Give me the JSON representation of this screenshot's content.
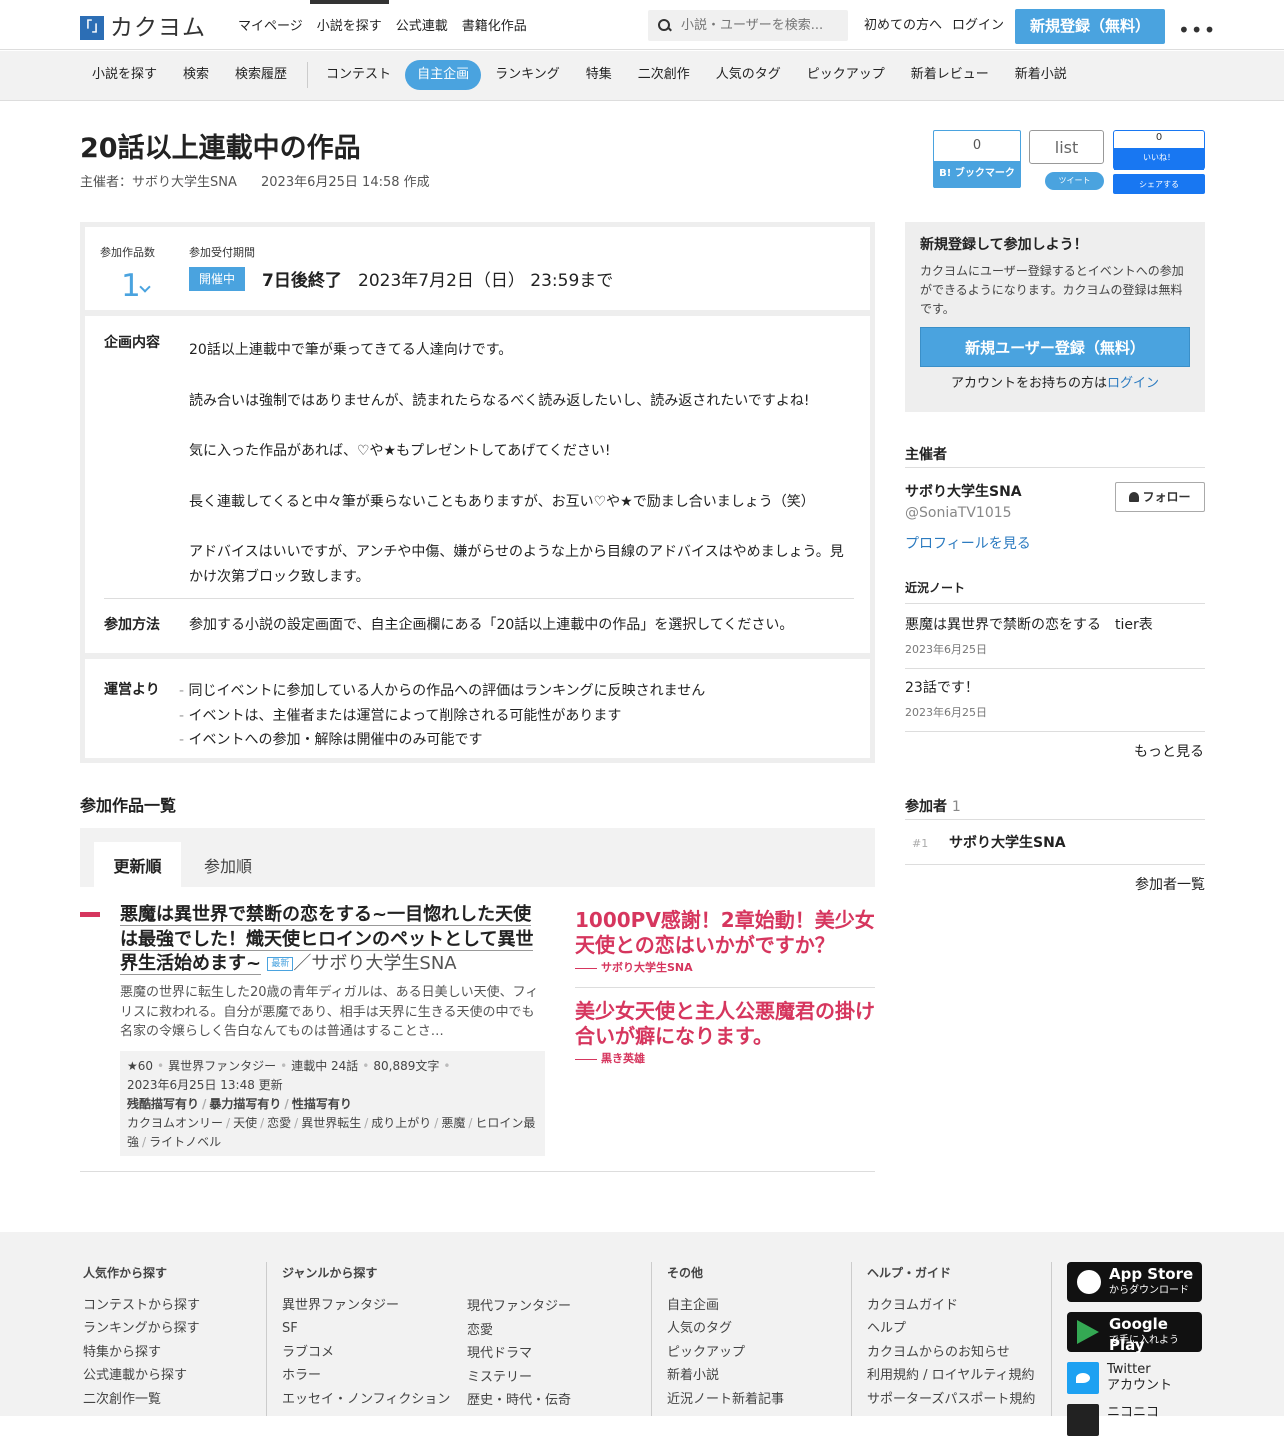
{
  "header": {
    "logo_mark": "「」",
    "logo_text": "カクヨム",
    "nav": [
      "マイページ",
      "小説を探す",
      "公式連載",
      "書籍化作品"
    ],
    "search_placeholder": "小説・ユーザーを検索...",
    "first_time": "初めての方へ",
    "login": "ログイン",
    "signup": "新規登録（無料）",
    "more": "•••"
  },
  "subnav": {
    "left": [
      "小説を探す",
      "検索",
      "検索履歴"
    ],
    "right": [
      "コンテスト",
      "自主企画",
      "ランキング",
      "特集",
      "二次創作",
      "人気のタグ",
      "ピックアップ",
      "新着レビュー",
      "新着小説"
    ]
  },
  "event": {
    "title": "20話以上連載中の作品",
    "organizer": "主催者：サボり大学生SNA",
    "created": "2023年6月25日 14:58 作成",
    "count_label": "参加作品数",
    "count": "1",
    "period_label": "参加受付期間",
    "status": "開催中",
    "remaining": "7日後終了",
    "deadline": "2023年7月2日（日） 23:59まで",
    "content_label": "企画内容",
    "content": [
      "20話以上連載中で筆が乗ってきてる人達向けです。",
      "読み合いは強制ではありませんが、読まれたらなるべく読み返したいし、読み返されたいですよね!",
      "気に入った作品があれば、♡や★もプレゼントしてあげてください!",
      "長く連載してくると中々筆が乗らないこともありますが、お互い♡や★で励まし合いましょう（笑）",
      "アドバイスはいいですが、アンチや中傷、嫌がらせのような上から目線のアドバイスはやめましょう。見かけ次第ブロック致します。"
    ],
    "method_label": "参加方法",
    "method": "参加する小説の設定画面で、自主企画欄にある「20話以上連載中の作品」を選択してください。",
    "notes_label": "運営より",
    "notes": [
      "同じイベントに参加している人からの作品への評価はランキングに反映されません",
      "イベントは、主催者または運営によって削除される可能性があります",
      "イベントへの参加・解除は開催中のみ可能です"
    ]
  },
  "share": {
    "hatena_count": "0",
    "hatena_label": "B! ブックマーク",
    "list_label": "list",
    "tweet_label": "ツイート",
    "fb_count": "0",
    "fb_like": "いいね！",
    "fb_share": "シェアする"
  },
  "works": {
    "section_title": "参加作品一覧",
    "tabs": [
      "更新順",
      "参加順"
    ],
    "item": {
      "title": "悪魔は異世界で禁断の恋をする~一目惚れした天使は最強でした！熾天使ヒロインのペットとして異世界生活始めます~",
      "new_badge": "最新",
      "author": "／サボり大学生SNA",
      "intro": "悪魔の世界に転生した20歳の青年ディガルは、ある日美しい天使、フィリスに救われる。自分が悪魔であり、相手は天界に生きる天使の中でも名家の令嬢らしく告白なんてものは普通はすることさ…",
      "stars": "★60",
      "genre": "異世界ファンタジー",
      "episodes": "連載中 24話",
      "chars": "80,889文字",
      "updated": "2023年6月25日 13:48 更新",
      "warnings": [
        "残酷描写有り",
        "暴力描写有り",
        "性描写有り"
      ],
      "tags": [
        "カクヨムオンリー",
        "天使",
        "恋愛",
        "異世界転生",
        "成り上がり",
        "悪魔",
        "ヒロイン最強",
        "ライトノベル"
      ]
    },
    "catchphrases": [
      {
        "text": "1000PV感謝！2章始動！美少女天使との恋はいかがですか？",
        "author": "サボり大学生SNA"
      },
      {
        "text": "美少女天使と主人公悪魔君の掛け合いが癖になります。",
        "author": "黒き英雄"
      }
    ]
  },
  "sidebar": {
    "signup_title": "新規登録して参加しよう！",
    "signup_text": "カクヨムにユーザー登録するとイベントへの参加ができるようになります。カクヨムの登録は無料です。",
    "signup_button": "新規ユーザー登録（無料）",
    "login_prompt": "アカウントをお持ちの方は",
    "login_link": "ログイン",
    "host_heading": "主催者",
    "host_name": "サボり大学生SNA",
    "host_id": "@SoniaTV1015",
    "follow": "フォロー",
    "profile_link": "プロフィールを見る",
    "notes_heading": "近況ノート",
    "notes": [
      {
        "title": "悪魔は異世界で禁断の恋をする　tier表",
        "date": "2023年6月25日"
      },
      {
        "title": "23話です！",
        "date": "2023年6月25日"
      }
    ],
    "more": "もっと見る",
    "members_heading": "参加者",
    "members_count": "1",
    "members": [
      {
        "rank": "#1",
        "name": "サボり大学生SNA"
      }
    ],
    "members_link": "参加者一覧"
  },
  "footer": {
    "col1": {
      "title": "人気作から探す",
      "links": [
        "コンテストから探す",
        "ランキングから探す",
        "特集から探す",
        "公式連載から探す",
        "二次創作一覧"
      ]
    },
    "col2": {
      "title": "ジャンルから探す",
      "links_a": [
        "異世界ファンタジー",
        "SF",
        "ラブコメ",
        "ホラー",
        "エッセイ・ノンフィクション"
      ],
      "links_b": [
        "現代ファンタジー",
        "恋愛",
        "現代ドラマ",
        "ミステリー",
        "歴史・時代・伝奇"
      ]
    },
    "col3": {
      "title": "その他",
      "links": [
        "自主企画",
        "人気のタグ",
        "ピックアップ",
        "新着小説",
        "近況ノート新着記事"
      ]
    },
    "col4": {
      "title": "ヘルプ・ガイド",
      "links": [
        "カクヨムガイド",
        "ヘルプ",
        "カクヨムからのお知らせ",
        "利用規約 / ロイヤルティ規約",
        "サポーターズパスポート規約"
      ]
    },
    "appstore": {
      "l1": "App Store",
      "l2": "からダウンロード"
    },
    "googleplay": {
      "l1": "Google Play",
      "l2": "で手に入れよう"
    },
    "twitter": {
      "l1": "Twitter",
      "l2": "アカウント"
    },
    "nico": "ニコニコ"
  }
}
